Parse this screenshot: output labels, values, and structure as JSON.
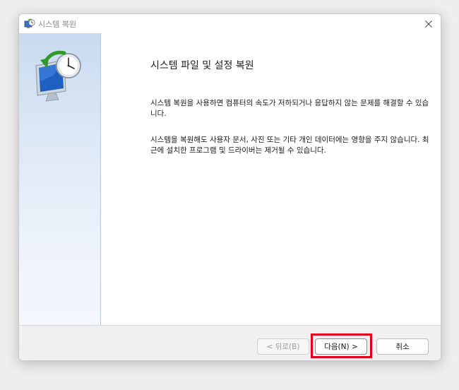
{
  "window": {
    "title": "시스템 복원",
    "close_icon": "close-icon"
  },
  "sidebar": {
    "illustration_icon": "system-restore-clock-monitor-icon"
  },
  "content": {
    "heading": "시스템 파일 및 설정 복원",
    "paragraph1": "시스템 복원을 사용하면 컴퓨터의 속도가 저하되거나 응답하지 않는 문제를 해결할 수 있습니다.",
    "paragraph2": "시스템을 복원해도 사용자 문서, 사진 또는 기타 개인 데이터에는 영향을 주지 않습니다. 최근에 설치한 프로그램 및 드라이버는 제거될 수 있습니다."
  },
  "buttons": {
    "back_label": "< 뒤로(B)",
    "next_label": "다음(N) >",
    "cancel_label": "취소"
  },
  "colors": {
    "highlight": "#e0001a",
    "sidebar_top": "#c9daf0",
    "sidebar_bottom": "#f4f7fc"
  }
}
